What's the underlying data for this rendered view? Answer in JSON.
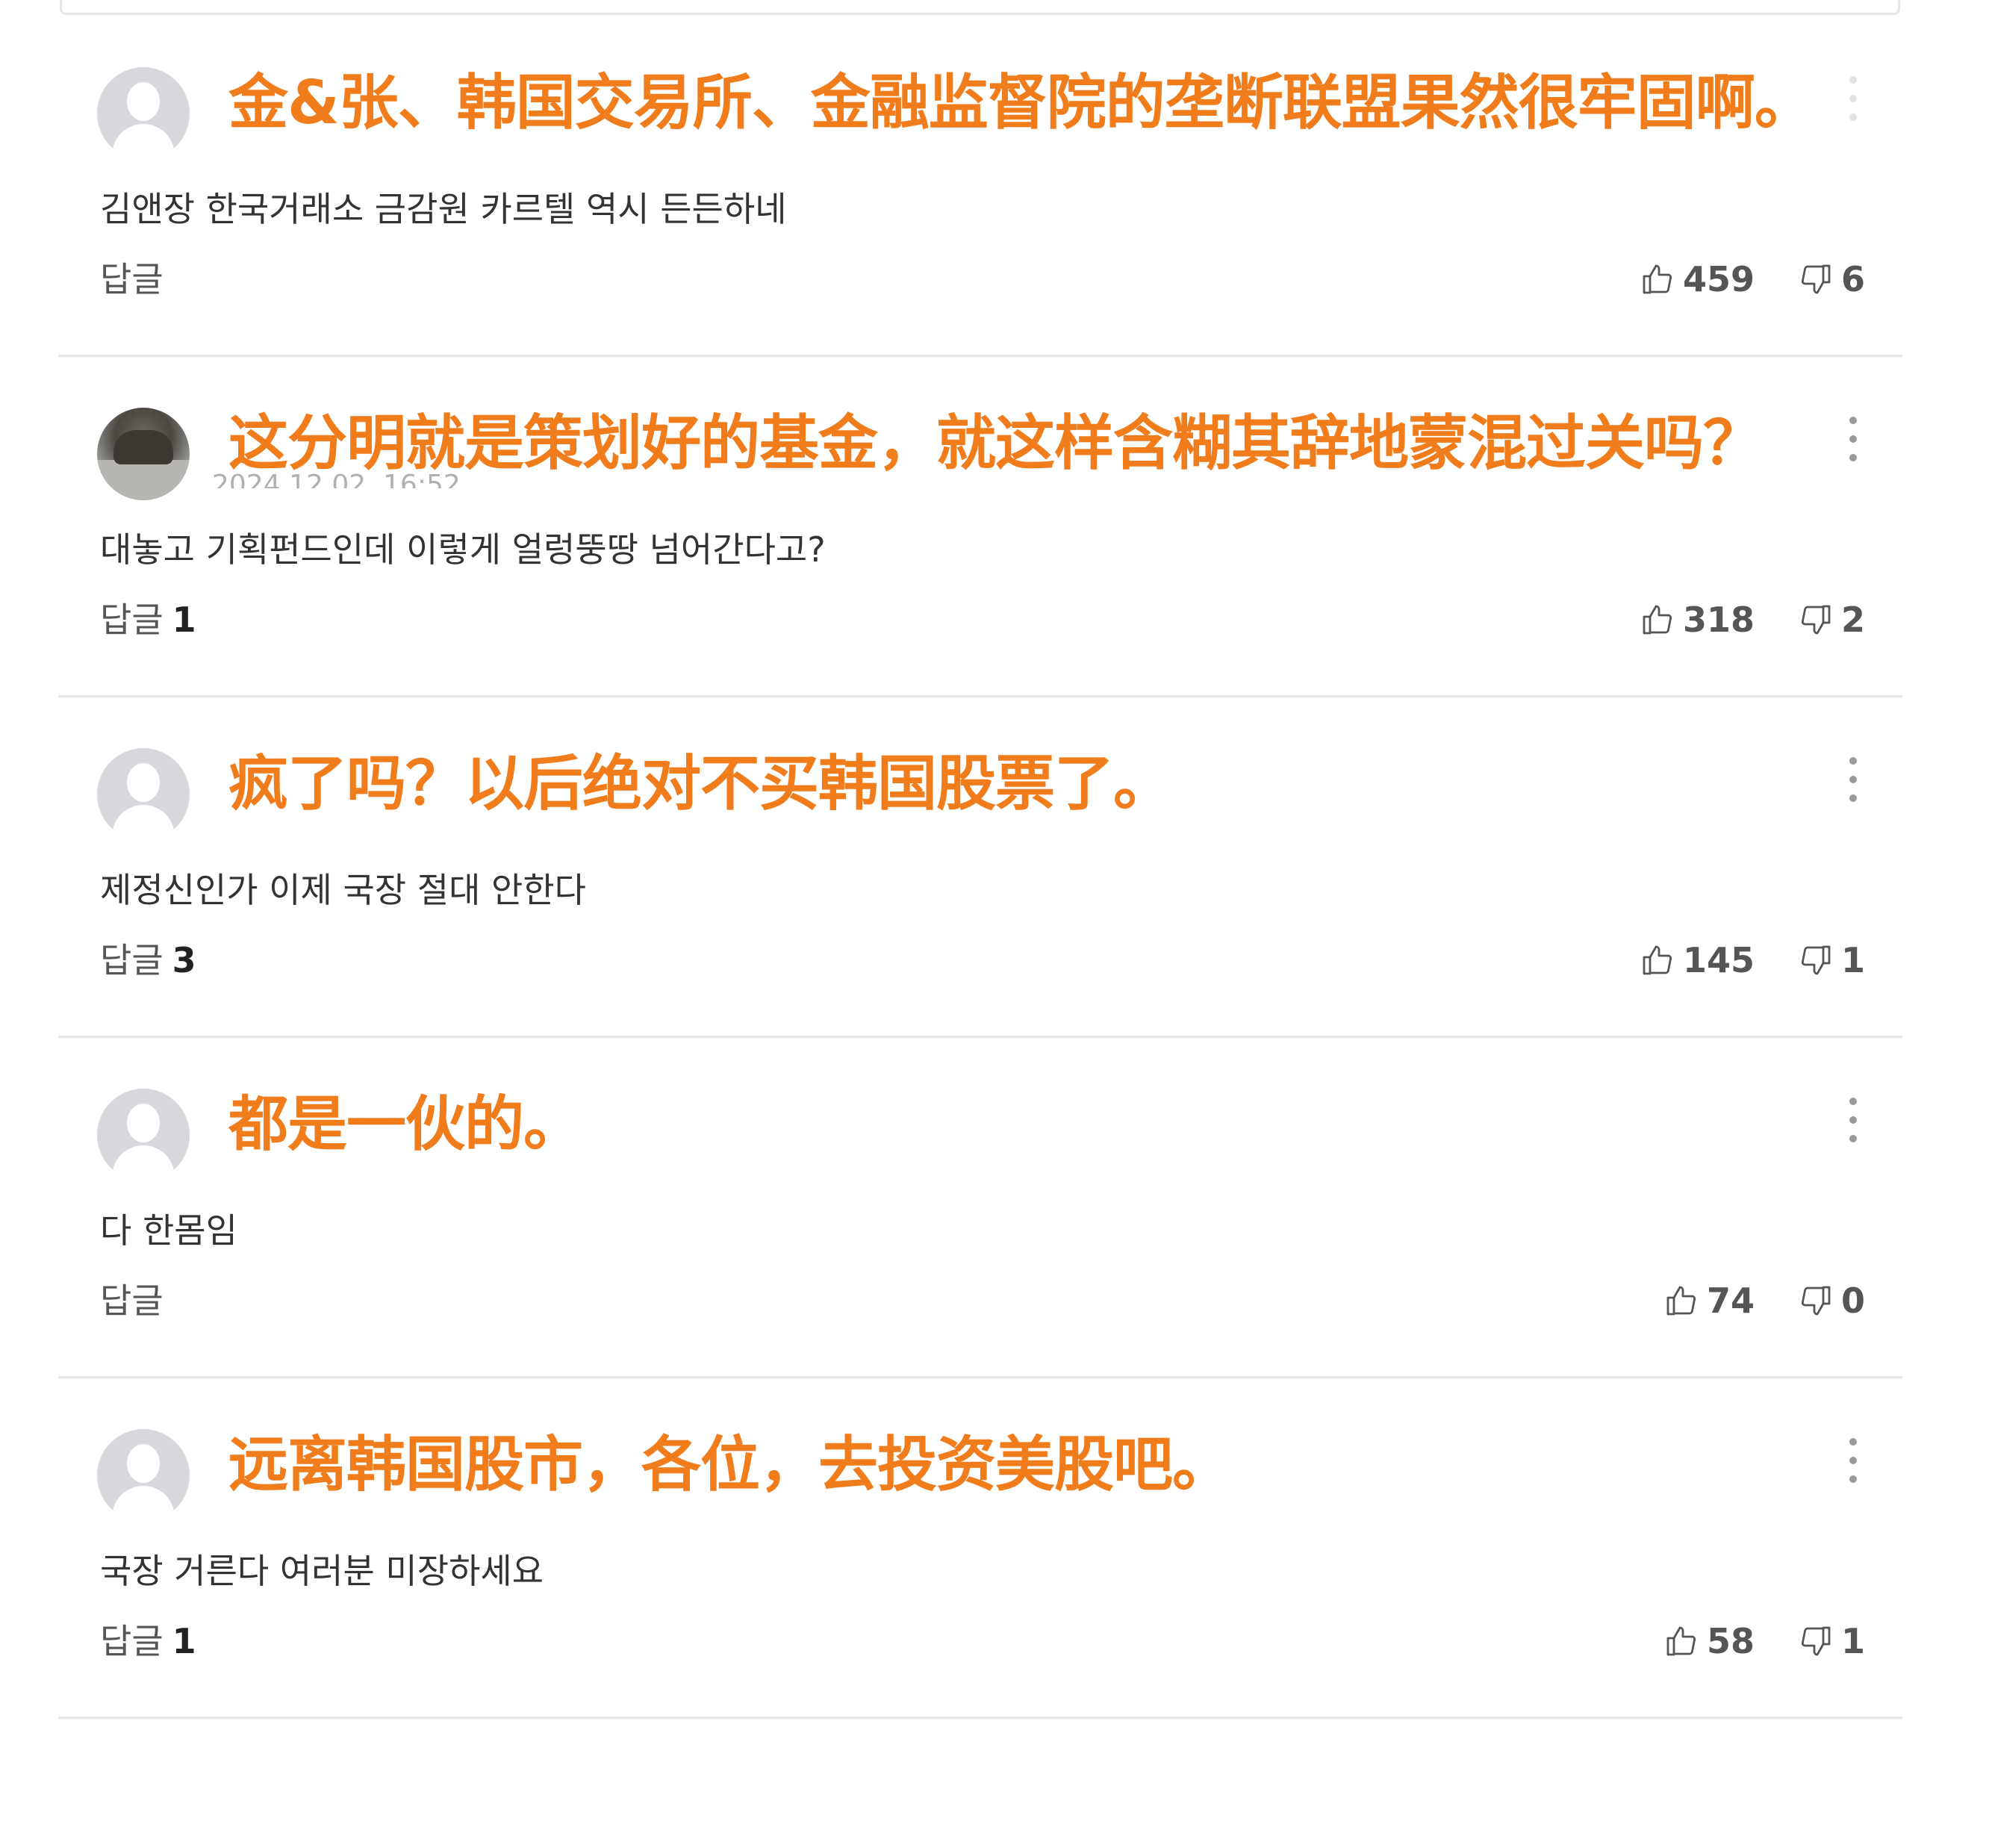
{
  "comments": [
    {
      "avatar": "default-avatar",
      "translation": "金&张、韩国交易所、金融监督院的垄断联盟果然很牢固啊。",
      "timestamp": "",
      "text": "김앤장 한국거래소 금감원 카르텔 역시 든든하네",
      "reply_label": "답글",
      "reply_count": "",
      "likes": "459",
      "dislikes": "6"
    },
    {
      "avatar": "photo-avatar",
      "translation": "这分明就是策划好的基金，就这样含糊其辞地蒙混过关吗？",
      "timestamp": "2024.12.02. 16:52",
      "text": "대놓고 기획펀드인데 이렇게 얼렁뚱땅 넘어간다고?",
      "reply_label": "답글",
      "reply_count": "1",
      "likes": "318",
      "dislikes": "2"
    },
    {
      "avatar": "default-avatar",
      "translation": "疯了吗？以后绝对不买韩国股票了。",
      "timestamp": "",
      "text": "제정신인가 이제 국장 절대 안한다",
      "reply_label": "답글",
      "reply_count": "3",
      "likes": "145",
      "dislikes": "1"
    },
    {
      "avatar": "default-avatar",
      "translation": "都是一伙的。",
      "timestamp": "",
      "text": "다 한몸임",
      "reply_label": "답글",
      "reply_count": "",
      "likes": "74",
      "dislikes": "0"
    },
    {
      "avatar": "default-avatar",
      "translation": "远离韩国股市，各位，去投资美股吧。",
      "timestamp": "",
      "text": "국장 거른다 여러분 미장하세요",
      "reply_label": "답글",
      "reply_count": "1",
      "likes": "58",
      "dislikes": "1"
    }
  ],
  "colors": {
    "translation_text": "#f07c1c",
    "body_text": "#333333",
    "divider": "#e6e6e6",
    "avatar_bg": "#d6d8dc",
    "icon": "#555555"
  },
  "icons": {
    "like": "thumbs-up-icon",
    "dislike": "thumbs-down-icon",
    "more": "more-vertical-icon",
    "avatar": "default-avatar-icon"
  }
}
